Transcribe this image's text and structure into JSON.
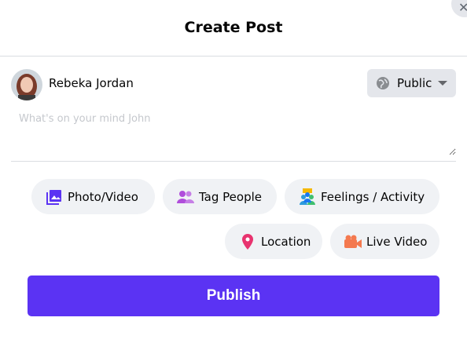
{
  "dialog": {
    "title": "Create Post",
    "close_icon": "close-icon"
  },
  "author": {
    "name": "Rebeka Jordan",
    "avatar_icon": "user-avatar"
  },
  "privacy": {
    "label": "Public",
    "icon": "globe-icon",
    "caret_icon": "caret-down-icon"
  },
  "composer": {
    "value": "",
    "placeholder": "What's on your mind John"
  },
  "actions": {
    "photo_video": "Photo/Video",
    "tag_people": "Tag People",
    "feelings_activity": "Feelings / Activity",
    "location": "Location",
    "live_video": "Live Video"
  },
  "publish_label": "Publish",
  "colors": {
    "publish": "#5b33f3",
    "photo_icon": "#5b33f3",
    "tag_icon": "#b04ddb",
    "location_icon": "#e8336f",
    "live_icon": "#f4794f"
  }
}
